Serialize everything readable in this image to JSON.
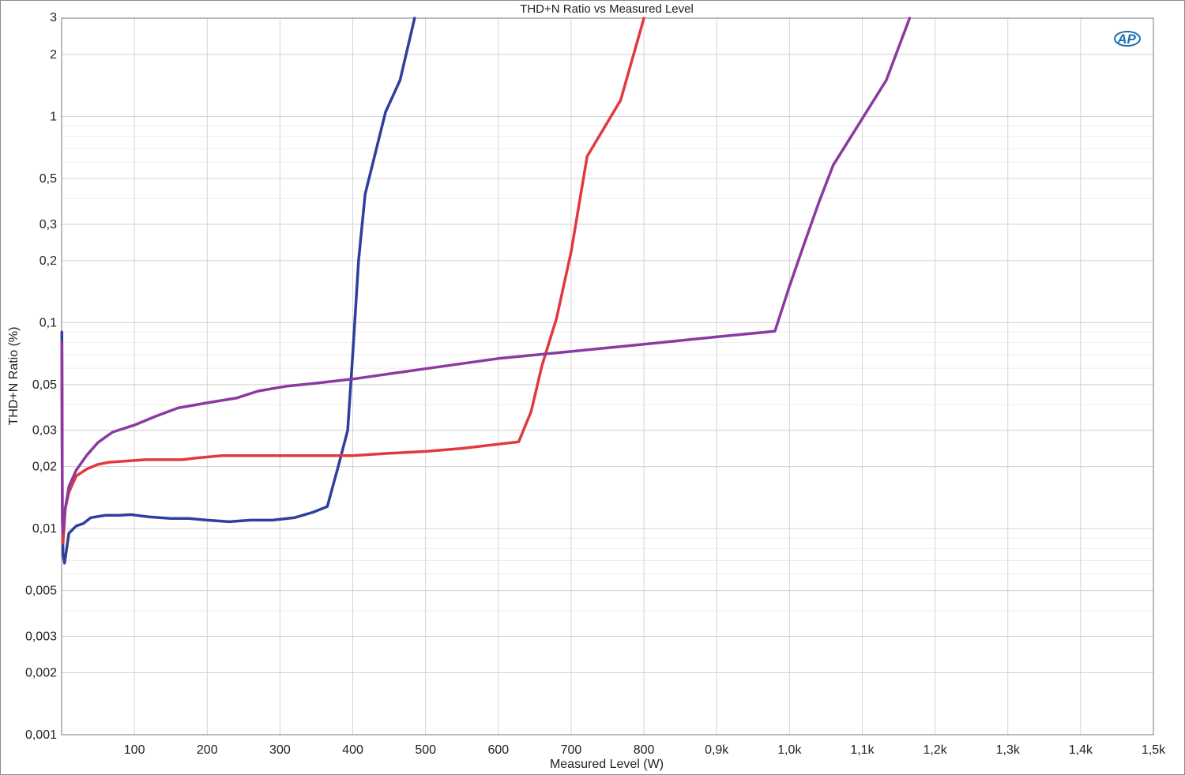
{
  "chart_data": {
    "type": "line",
    "title": "THD+N Ratio vs Measured Level",
    "xlabel": "Measured Level (W)",
    "ylabel": "THD+N Ratio (%)",
    "xlim": [
      0,
      1500
    ],
    "ylim": [
      0.001,
      3
    ],
    "yscale": "log",
    "grid": true,
    "logo": "AP",
    "x_ticks": [
      {
        "value": 100,
        "label": "100"
      },
      {
        "value": 200,
        "label": "200"
      },
      {
        "value": 300,
        "label": "300"
      },
      {
        "value": 400,
        "label": "400"
      },
      {
        "value": 500,
        "label": "500"
      },
      {
        "value": 600,
        "label": "600"
      },
      {
        "value": 700,
        "label": "700"
      },
      {
        "value": 800,
        "label": "800"
      },
      {
        "value": 900,
        "label": "0,9k"
      },
      {
        "value": 1000,
        "label": "1,0k"
      },
      {
        "value": 1100,
        "label": "1,1k"
      },
      {
        "value": 1200,
        "label": "1,2k"
      },
      {
        "value": 1300,
        "label": "1,3k"
      },
      {
        "value": 1400,
        "label": "1,4k"
      },
      {
        "value": 1500,
        "label": "1,5k"
      }
    ],
    "y_ticks": [
      {
        "value": 0.001,
        "label": "0,001"
      },
      {
        "value": 0.002,
        "label": "0,002"
      },
      {
        "value": 0.003,
        "label": "0,003"
      },
      {
        "value": 0.005,
        "label": "0,005"
      },
      {
        "value": 0.01,
        "label": "0,01"
      },
      {
        "value": 0.02,
        "label": "0,02"
      },
      {
        "value": 0.03,
        "label": "0,03"
      },
      {
        "value": 0.05,
        "label": "0,05"
      },
      {
        "value": 0.1,
        "label": "0,1"
      },
      {
        "value": 0.2,
        "label": "0,2"
      },
      {
        "value": 0.3,
        "label": "0,3"
      },
      {
        "value": 0.5,
        "label": "0,5"
      },
      {
        "value": 1,
        "label": "1"
      },
      {
        "value": 2,
        "label": "2"
      },
      {
        "value": 3,
        "label": "3"
      }
    ],
    "series": [
      {
        "color": "#2e3f9e",
        "points": [
          [
            0.3,
            0.09
          ],
          [
            1,
            0.012
          ],
          [
            2,
            0.0075
          ],
          [
            4,
            0.0068
          ],
          [
            10,
            0.0095
          ],
          [
            20,
            0.0103
          ],
          [
            30,
            0.0106
          ],
          [
            40,
            0.0113
          ],
          [
            60,
            0.0116
          ],
          [
            80,
            0.0116
          ],
          [
            95,
            0.0117
          ],
          [
            120,
            0.0114
          ],
          [
            150,
            0.0112
          ],
          [
            175,
            0.0112
          ],
          [
            200,
            0.011
          ],
          [
            230,
            0.0108
          ],
          [
            260,
            0.011
          ],
          [
            290,
            0.011
          ],
          [
            320,
            0.0113
          ],
          [
            345,
            0.012
          ],
          [
            365,
            0.0128
          ],
          [
            380,
            0.02
          ],
          [
            393,
            0.03
          ],
          [
            400,
            0.07
          ],
          [
            408,
            0.2
          ],
          [
            417,
            0.42
          ],
          [
            445,
            1.05
          ],
          [
            465,
            1.5
          ],
          [
            485,
            3
          ]
        ]
      },
      {
        "color": "#e03a3e",
        "points": [
          [
            0.3,
            0.08
          ],
          [
            1,
            0.011
          ],
          [
            2,
            0.0085
          ],
          [
            5,
            0.0125
          ],
          [
            10,
            0.015
          ],
          [
            20,
            0.018
          ],
          [
            35,
            0.0195
          ],
          [
            50,
            0.0205
          ],
          [
            65,
            0.021
          ],
          [
            90,
            0.0213
          ],
          [
            115,
            0.0216
          ],
          [
            140,
            0.0216
          ],
          [
            165,
            0.0216
          ],
          [
            190,
            0.0221
          ],
          [
            220,
            0.0226
          ],
          [
            260,
            0.0226
          ],
          [
            300,
            0.0226
          ],
          [
            350,
            0.0226
          ],
          [
            400,
            0.0226
          ],
          [
            450,
            0.0232
          ],
          [
            500,
            0.0237
          ],
          [
            550,
            0.0245
          ],
          [
            600,
            0.0257
          ],
          [
            628,
            0.0264
          ],
          [
            645,
            0.037
          ],
          [
            660,
            0.062
          ],
          [
            680,
            0.105
          ],
          [
            700,
            0.22
          ],
          [
            722,
            0.64
          ],
          [
            768,
            1.2
          ],
          [
            800,
            3
          ]
        ]
      },
      {
        "color": "#8a3aa0",
        "points": [
          [
            0.3,
            0.08
          ],
          [
            1,
            0.012
          ],
          [
            2,
            0.0095
          ],
          [
            5,
            0.0125
          ],
          [
            10,
            0.016
          ],
          [
            20,
            0.0192
          ],
          [
            35,
            0.0228
          ],
          [
            50,
            0.0262
          ],
          [
            70,
            0.0294
          ],
          [
            100,
            0.0318
          ],
          [
            130,
            0.0352
          ],
          [
            160,
            0.0385
          ],
          [
            200,
            0.0408
          ],
          [
            240,
            0.043
          ],
          [
            270,
            0.0465
          ],
          [
            310,
            0.0492
          ],
          [
            350,
            0.0508
          ],
          [
            400,
            0.0532
          ],
          [
            500,
            0.0597
          ],
          [
            600,
            0.0669
          ],
          [
            700,
            0.0724
          ],
          [
            800,
            0.0785
          ],
          [
            900,
            0.0852
          ],
          [
            980,
            0.0908
          ],
          [
            1000,
            0.15
          ],
          [
            1020,
            0.24
          ],
          [
            1040,
            0.38
          ],
          [
            1060,
            0.58
          ],
          [
            1133,
            1.5
          ],
          [
            1165,
            3
          ]
        ]
      }
    ]
  }
}
